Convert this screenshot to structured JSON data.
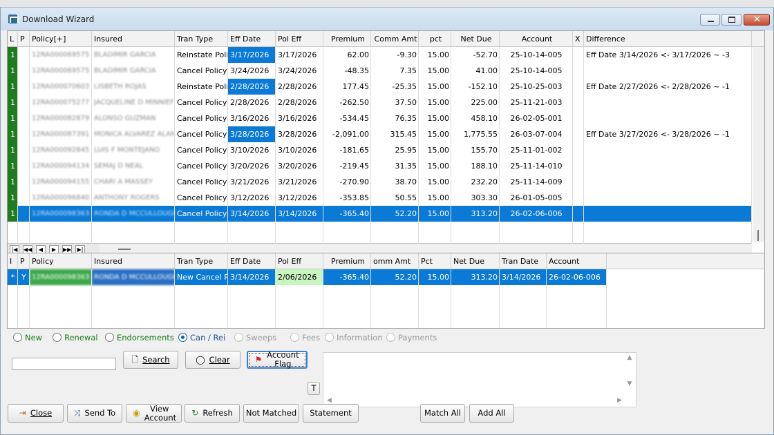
{
  "window": {
    "title": "Download Wizard",
    "min_icon": "minimize-icon",
    "max_icon": "maximize-icon",
    "close_icon": "close-icon"
  },
  "top_grid": {
    "columns": [
      "L",
      "P",
      "Policy[+]",
      "Insured",
      "Tran Type",
      "Eff Date",
      "Pol Eff",
      "Premium",
      "Comm Amt",
      "pct",
      "Net Due",
      "Account",
      "X",
      "Difference"
    ],
    "rows": [
      {
        "l": "1",
        "p": "",
        "policy": "12RA000069575",
        "insured": "BLADIMIR GARCIA",
        "tran_type": "Reinstate Policy",
        "eff_date": "3/17/2026",
        "pol_eff": "3/17/2026",
        "premium": "62.00",
        "comm": "-9.30",
        "pct": "15.00",
        "net_due": "-52.70",
        "account": "25-10-14-005",
        "x": "",
        "difference": "Eff Date  3/14/2026 <-  3/17/2026 ~ -3",
        "eff_hl": true
      },
      {
        "l": "1",
        "p": "",
        "policy": "12RA000069575",
        "insured": "BLADIMIR GARCIA",
        "tran_type": "Cancel Policy",
        "eff_date": "3/24/2026",
        "pol_eff": "3/24/2026",
        "premium": "-48.35",
        "comm": "7.35",
        "pct": "15.00",
        "net_due": "41.00",
        "account": "25-10-14-005",
        "x": "",
        "difference": "",
        "eff_hl": false
      },
      {
        "l": "1",
        "p": "",
        "policy": "12RA000070603",
        "insured": "LISBETH ROJAS",
        "tran_type": "Reinstate Policy",
        "eff_date": "2/28/2026",
        "pol_eff": "2/28/2026",
        "premium": "177.45",
        "comm": "-25.35",
        "pct": "15.00",
        "net_due": "-152.10",
        "account": "25-10-25-003",
        "x": "",
        "difference": "Eff Date  2/27/2026 <-  2/28/2026 ~ -1",
        "eff_hl": true
      },
      {
        "l": "1",
        "p": "",
        "policy": "12RA000075277",
        "insured": "JACQUELINE D MINNIEF",
        "tran_type": "Cancel Policy",
        "eff_date": "2/28/2026",
        "pol_eff": "2/28/2026",
        "premium": "-262.50",
        "comm": "37.50",
        "pct": "15.00",
        "net_due": "225.00",
        "account": "25-11-21-003",
        "x": "",
        "difference": "",
        "eff_hl": false
      },
      {
        "l": "1",
        "p": "",
        "policy": "12RA000082879",
        "insured": "ALONSO GUZMAN",
        "tran_type": "Cancel Policy",
        "eff_date": "3/16/2026",
        "pol_eff": "3/16/2026",
        "premium": "-534.45",
        "comm": "76.35",
        "pct": "15.00",
        "net_due": "458.10",
        "account": "26-02-05-001",
        "x": "",
        "difference": "",
        "eff_hl": false
      },
      {
        "l": "1",
        "p": "",
        "policy": "12RA000087391",
        "insured": "MONICA ALVAREZ ALAN",
        "tran_type": "Cancel Policy",
        "eff_date": "3/28/2026",
        "pol_eff": "3/28/2026",
        "premium": "-2,091.00",
        "comm": "315.45",
        "pct": "15.00",
        "net_due": "1,775.55",
        "account": "26-03-07-004",
        "x": "",
        "difference": "Eff Date  3/27/2026 <-  3/28/2026 ~ -1",
        "eff_hl": true
      },
      {
        "l": "1",
        "p": "",
        "policy": "12RA000092845",
        "insured": "LUIS F MONTEJANO",
        "tran_type": "Cancel Policy",
        "eff_date": "3/10/2026",
        "pol_eff": "3/10/2026",
        "premium": "-181.65",
        "comm": "25.95",
        "pct": "15.00",
        "net_due": "155.70",
        "account": "25-11-01-002",
        "x": "",
        "difference": "",
        "eff_hl": false
      },
      {
        "l": "1",
        "p": "",
        "policy": "12RA000094134",
        "insured": "SEMAJ D NEAL",
        "tran_type": "Cancel Policy",
        "eff_date": "3/20/2026",
        "pol_eff": "3/20/2026",
        "premium": "-219.45",
        "comm": "31.35",
        "pct": "15.00",
        "net_due": "188.10",
        "account": "25-11-14-010",
        "x": "",
        "difference": "",
        "eff_hl": false
      },
      {
        "l": "1",
        "p": "",
        "policy": "12RA000094155",
        "insured": "CHARI A MASSEY",
        "tran_type": "Cancel Policy",
        "eff_date": "3/21/2026",
        "pol_eff": "3/21/2026",
        "premium": "-270.90",
        "comm": "38.70",
        "pct": "15.00",
        "net_due": "232.20",
        "account": "25-11-14-009",
        "x": "",
        "difference": "",
        "eff_hl": false
      },
      {
        "l": "1",
        "p": "",
        "policy": "12RA000096840",
        "insured": "ANTHONY ROGERS",
        "tran_type": "Cancel Policy",
        "eff_date": "3/12/2026",
        "pol_eff": "3/12/2026",
        "premium": "-353.85",
        "comm": "50.55",
        "pct": "15.00",
        "net_due": "303.30",
        "account": "26-01-05-005",
        "x": "",
        "difference": "",
        "eff_hl": false
      },
      {
        "l": "1",
        "p": "",
        "policy": "12RA000098363",
        "insured": "RONDA D MCCULLOUGH",
        "tran_type": "Cancel Policy",
        "eff_date": "3/14/2026",
        "pol_eff": "3/14/2026",
        "premium": "-365.40",
        "comm": "52.20",
        "pct": "15.00",
        "net_due": "313.20",
        "account": "26-02-06-006",
        "x": "",
        "difference": "",
        "eff_hl": false,
        "selected": true
      }
    ],
    "nav": [
      "|◀",
      "◀◀",
      "◀",
      "▶",
      "▶▶",
      "▶|"
    ]
  },
  "bottom_grid": {
    "columns": [
      "I",
      "P",
      "Policy",
      "Insured",
      "Tran Type",
      "Eff Date",
      "Pol Eff",
      "Premium",
      "omm Amt",
      "Pct",
      "Net Due",
      "Tran Date",
      "Account"
    ],
    "rows": [
      {
        "i": "*",
        "p": "Y",
        "policy": "12RA000098363",
        "insured": "RONDA D MCCULLOUGH",
        "tran_type": "New Cancel Policy",
        "eff_date": "3/14/2026",
        "pol_eff": "2/06/2026",
        "premium": "-365.40",
        "comm": "52.20",
        "pct": "15.00",
        "net_due": "313.20",
        "tran_date": "3/14/2026",
        "account": "26-02-06-006"
      }
    ]
  },
  "filters": [
    {
      "label": "New",
      "checked": false,
      "style": "green"
    },
    {
      "label": "Renewal",
      "checked": false,
      "style": "green"
    },
    {
      "label": "Endorsements",
      "checked": false,
      "style": "green"
    },
    {
      "label": "Can / Rei",
      "checked": true,
      "style": "blue"
    },
    {
      "label": "Sweeps",
      "checked": false,
      "style": "dis"
    },
    {
      "label": "Fees",
      "checked": false,
      "style": "dis"
    },
    {
      "label": "Information",
      "checked": false,
      "style": "dis"
    },
    {
      "label": "Payments",
      "checked": false,
      "style": "dis"
    }
  ],
  "search": {
    "value": "",
    "search_label": "Search",
    "clear_label": "Clear",
    "flag_label": "Account Flag",
    "t_label": "T"
  },
  "footer": {
    "close": "Close",
    "send_to": "Send To",
    "view_account": "View Account",
    "refresh": "Refresh",
    "not_matched": "Not Matched",
    "statement": "Statement",
    "match_all": "Match All",
    "add_all": "Add All"
  },
  "colors": {
    "selection": "#0a7ad6",
    "green_marker": "#1e7b1e",
    "pol_eff_highlight": "#c8f5c0"
  }
}
